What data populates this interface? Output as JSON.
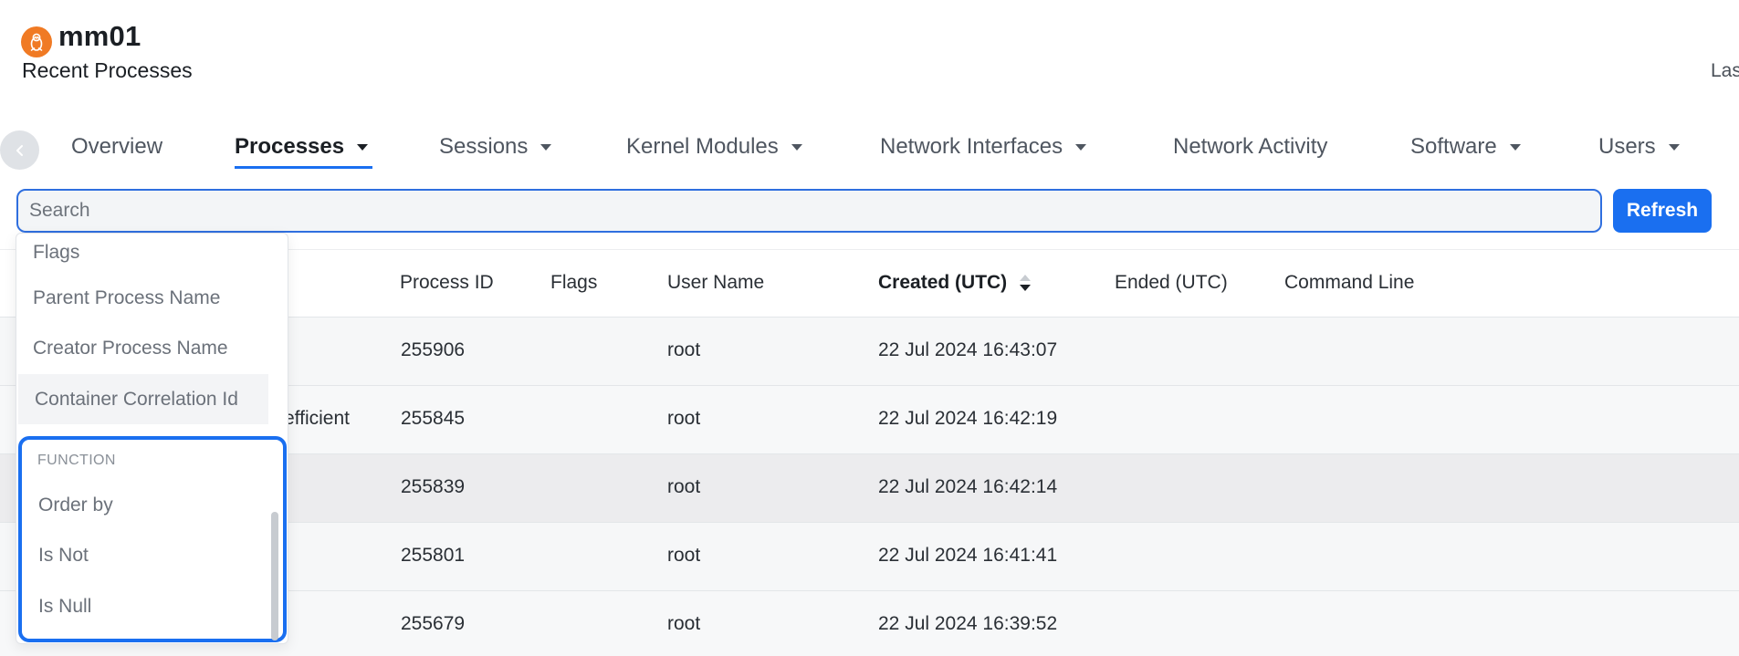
{
  "header": {
    "host_name": "mm01",
    "subtitle": "Recent Processes",
    "last_updated_prefix": "Las",
    "os_icon": "linux-penguin-icon",
    "os_badge_color": "#f07a24"
  },
  "tabs": [
    {
      "label": "Overview",
      "has_caret": false,
      "active": false
    },
    {
      "label": "Processes",
      "has_caret": true,
      "active": true
    },
    {
      "label": "Sessions",
      "has_caret": true,
      "active": false
    },
    {
      "label": "Kernel Modules",
      "has_caret": true,
      "active": false
    },
    {
      "label": "Network Interfaces",
      "has_caret": true,
      "active": false
    },
    {
      "label": "Network Activity",
      "has_caret": false,
      "active": false
    },
    {
      "label": "Software",
      "has_caret": true,
      "active": false
    },
    {
      "label": "Users",
      "has_caret": true,
      "active": false
    }
  ],
  "search": {
    "placeholder": "Search",
    "value": ""
  },
  "toolbar": {
    "refresh_label": "Refresh"
  },
  "accent_color": "#1a6ff0",
  "table": {
    "columns": [
      {
        "label": "Process ID"
      },
      {
        "label": "Flags"
      },
      {
        "label": "User Name"
      },
      {
        "label": "Created (UTC)",
        "sorted": "desc"
      },
      {
        "label": "Ended (UTC)"
      },
      {
        "label": "Command Line"
      }
    ],
    "rows": [
      {
        "name_fragment": "",
        "pid": "255906",
        "flags": "",
        "user": "root",
        "created": "22 Jul 2024 16:43:07",
        "ended": "",
        "cmd": ""
      },
      {
        "name_fragment": "efficient",
        "pid": "255845",
        "flags": "",
        "user": "root",
        "created": "22 Jul 2024 16:42:19",
        "ended": "",
        "cmd": ""
      },
      {
        "name_fragment": "",
        "pid": "255839",
        "flags": "",
        "user": "root",
        "created": "22 Jul 2024 16:42:14",
        "ended": "",
        "cmd": ""
      },
      {
        "name_fragment": "",
        "pid": "255801",
        "flags": "",
        "user": "root",
        "created": "22 Jul 2024 16:41:41",
        "ended": "",
        "cmd": ""
      },
      {
        "name_fragment": "",
        "pid": "255679",
        "flags": "",
        "user": "root",
        "created": "22 Jul 2024 16:39:52",
        "ended": "",
        "cmd": ""
      }
    ]
  },
  "dropdown": {
    "field_items": [
      "Flags",
      "Parent Process Name",
      "Creator Process Name",
      "Container Correlation Id"
    ],
    "function_group_label": "FUNCTION",
    "function_items": [
      "Order by",
      "Is Not",
      "Is Null"
    ]
  }
}
